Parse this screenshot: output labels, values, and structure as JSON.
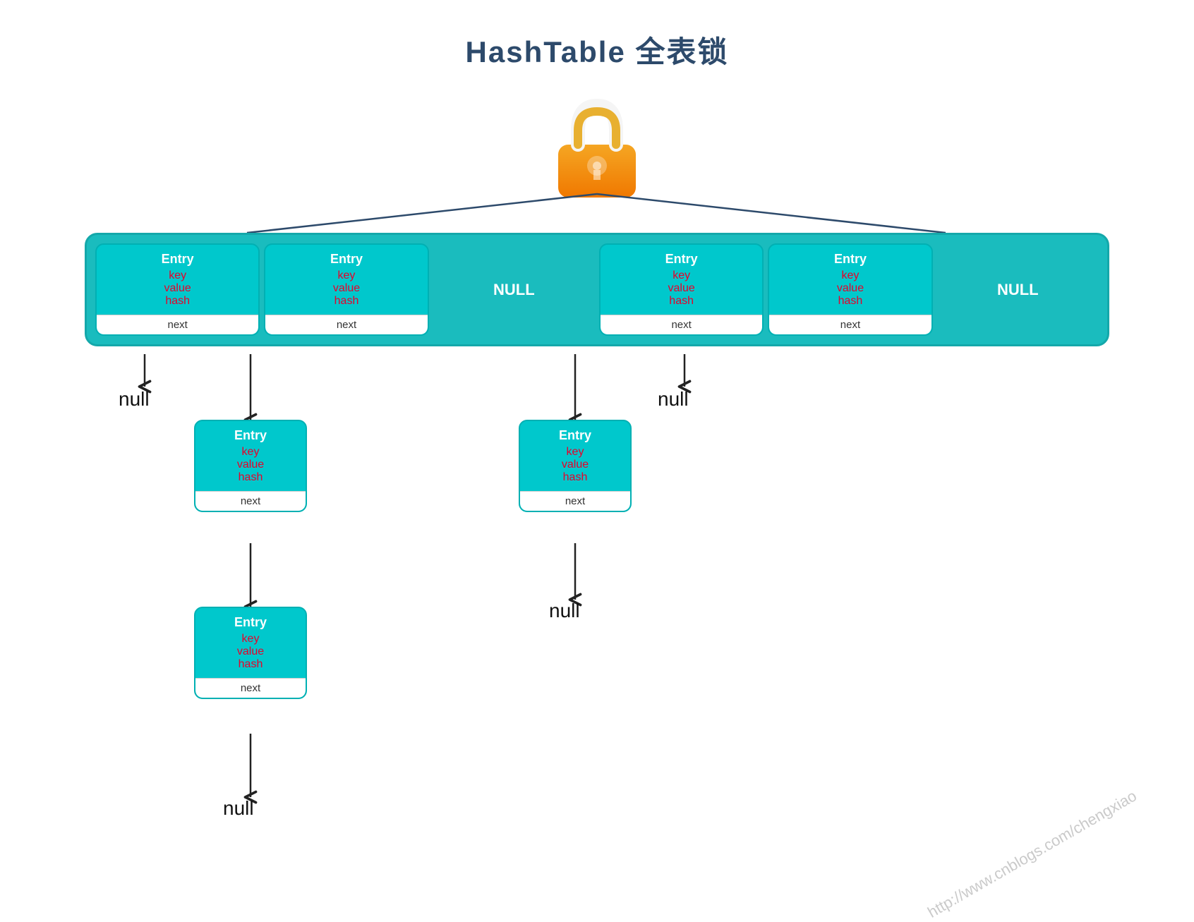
{
  "title": "HashTable 全表锁",
  "watermark": "http://www.cnblogs.com/chengxiao",
  "hashtable": {
    "cells": [
      {
        "type": "entry",
        "label": "Entry",
        "fields": [
          "key",
          "value",
          "hash"
        ],
        "next": "next"
      },
      {
        "type": "entry",
        "label": "Entry",
        "fields": [
          "key",
          "value",
          "hash"
        ],
        "next": "next"
      },
      {
        "type": "null",
        "label": "NULL"
      },
      {
        "type": "entry",
        "label": "Entry",
        "fields": [
          "key",
          "value",
          "hash"
        ],
        "next": "next"
      },
      {
        "type": "entry",
        "label": "Entry",
        "fields": [
          "key",
          "value",
          "hash"
        ],
        "next": "next"
      },
      {
        "type": "null",
        "label": "NULL"
      }
    ]
  },
  "chains": {
    "col1": {
      "null": "null",
      "cells": []
    },
    "col2": {
      "cells": [
        {
          "label": "Entry",
          "fields": [
            "key",
            "value",
            "hash"
          ],
          "next": "next"
        },
        {
          "label": "Entry",
          "fields": [
            "key",
            "value",
            "hash"
          ],
          "next": "next"
        }
      ],
      "null": "null"
    },
    "col4": {
      "cells": [
        {
          "label": "Entry",
          "fields": [
            "key",
            "value",
            "hash"
          ],
          "next": "next"
        }
      ],
      "null": "null"
    },
    "col5": {
      "null": "null",
      "cells": []
    }
  }
}
